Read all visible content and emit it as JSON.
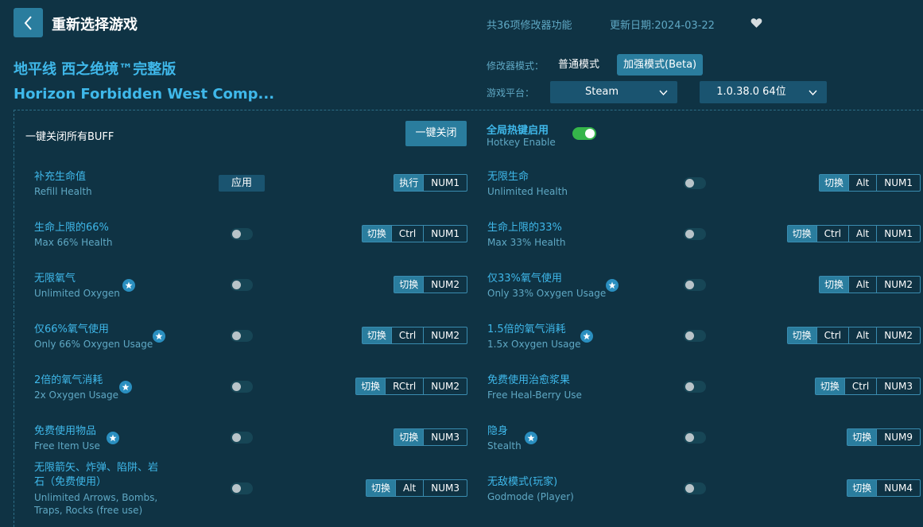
{
  "header": {
    "title": "重新选择游戏",
    "feature_count": "共36项修改器功能",
    "update_date": "更新日期:2024-03-22"
  },
  "game": {
    "name_cn": "地平线 西之绝境™完整版",
    "name_en": "Horizon Forbidden West Comp..."
  },
  "mode": {
    "label": "修改器模式：",
    "normal": "普通模式",
    "enhanced": "加强模式(Beta)"
  },
  "platform": {
    "label": "游戏平台：",
    "selected": "Steam",
    "version": "1.0.38.0 64位"
  },
  "controls": {
    "all_off_label": "一键关闭所有BUFF",
    "all_off_button": "一键关闭",
    "hotkey_cn": "全局热键启用",
    "hotkey_en": "Hotkey Enable"
  },
  "features": [
    {
      "cn": "补充生命值",
      "en": "Refill Health",
      "star": false,
      "control": "button",
      "button_label": "应用",
      "action": "执行",
      "keys": [
        "NUM1"
      ]
    },
    {
      "cn": "无限生命",
      "en": "Unlimited Health",
      "star": false,
      "control": "toggle",
      "action": "切换",
      "keys": [
        "Alt",
        "NUM1"
      ]
    },
    {
      "cn": "生命上限的66%",
      "en": "Max 66% Health",
      "star": false,
      "control": "toggle",
      "action": "切换",
      "keys": [
        "Ctrl",
        "NUM1"
      ]
    },
    {
      "cn": "生命上限的33%",
      "en": "Max 33% Health",
      "star": false,
      "control": "toggle",
      "action": "切换",
      "keys": [
        "Ctrl",
        "Alt",
        "NUM1"
      ]
    },
    {
      "cn": "无限氧气",
      "en": "Unlimited Oxygen",
      "star": true,
      "control": "toggle",
      "action": "切换",
      "keys": [
        "NUM2"
      ]
    },
    {
      "cn": "仅33%氧气使用",
      "en": "Only 33% Oxygen Usage",
      "star": true,
      "control": "toggle",
      "action": "切换",
      "keys": [
        "Alt",
        "NUM2"
      ]
    },
    {
      "cn": "仅66%氧气使用",
      "en": "Only 66% Oxygen Usage",
      "star": true,
      "control": "toggle",
      "action": "切换",
      "keys": [
        "Ctrl",
        "NUM2"
      ]
    },
    {
      "cn": "1.5倍的氧气消耗",
      "en": "1.5x Oxygen Usage",
      "star": true,
      "control": "toggle",
      "action": "切换",
      "keys": [
        "Ctrl",
        "Alt",
        "NUM2"
      ]
    },
    {
      "cn": "2倍的氧气消耗",
      "en": "2x Oxygen Usage",
      "star": true,
      "control": "toggle",
      "action": "切换",
      "keys": [
        "RCtrl",
        "NUM2"
      ]
    },
    {
      "cn": "免费使用治愈浆果",
      "en": "Free Heal-Berry Use",
      "star": false,
      "control": "toggle",
      "action": "切换",
      "keys": [
        "Ctrl",
        "NUM3"
      ]
    },
    {
      "cn": "免费使用物品",
      "en": "Free Item Use",
      "star": true,
      "control": "toggle",
      "action": "切换",
      "keys": [
        "NUM3"
      ]
    },
    {
      "cn": "隐身",
      "en": "Stealth",
      "star": true,
      "control": "toggle",
      "action": "切换",
      "keys": [
        "NUM9"
      ]
    },
    {
      "cn": "无限箭矢、炸弹、陷阱、岩",
      "cn2": "石（免费使用）",
      "en": "Unlimited Arrows, Bombs,",
      "en2": "Traps, Rocks (free use)",
      "star": false,
      "control": "toggle",
      "action": "切换",
      "keys": [
        "Alt",
        "NUM3"
      ]
    },
    {
      "cn": "无敌模式(玩家)",
      "en": "Godmode (Player)",
      "star": false,
      "control": "toggle",
      "action": "切换",
      "keys": [
        "NUM4"
      ]
    }
  ]
}
